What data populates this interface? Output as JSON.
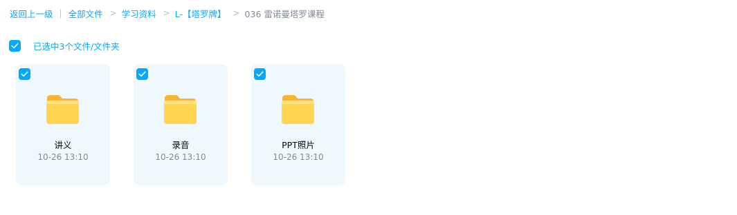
{
  "breadcrumb": {
    "back_label": "返回上一级",
    "items": [
      "全部文件",
      "学习资料",
      "L-【塔罗牌】"
    ],
    "current": "036 雷诺曼塔罗课程"
  },
  "selection": {
    "summary": "已选中3个文件/文件夹",
    "all_checked": true
  },
  "files": [
    {
      "name": "讲义",
      "modified": "10-26 13:10",
      "checked": true,
      "icon": "folder-icon"
    },
    {
      "name": "录音",
      "modified": "10-26 13:10",
      "checked": true,
      "icon": "folder-icon"
    },
    {
      "name": "PPT照片",
      "modified": "10-26 13:10",
      "checked": true,
      "icon": "folder-icon"
    }
  ],
  "colors": {
    "accent": "#06a7ff",
    "card_bg": "#eef8fd",
    "folder_body": "#ffd451",
    "folder_back": "#f8b531",
    "muted_text": "#818999"
  }
}
